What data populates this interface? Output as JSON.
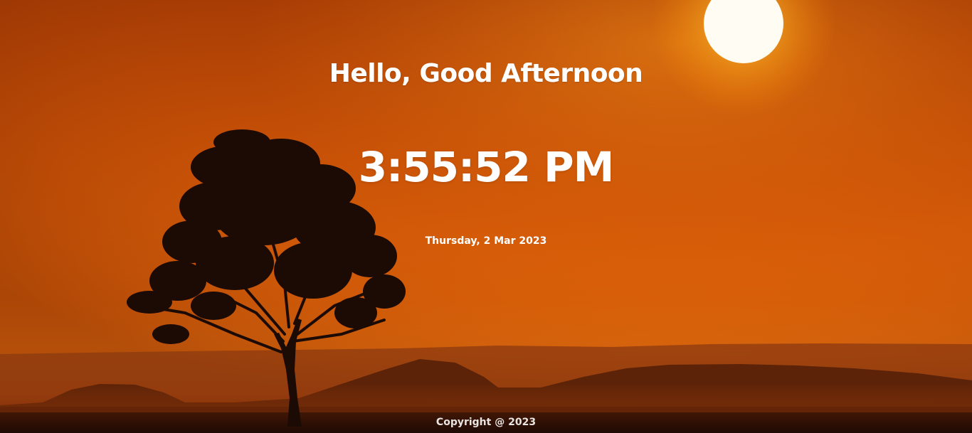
{
  "greeting": {
    "text": "Hello, Good Afternoon"
  },
  "clock": {
    "time": "3:55:52 PM"
  },
  "date": {
    "text": "Thursday, 2 Mar 2023"
  },
  "footer": {
    "copyright": "Copyright @ 2023"
  },
  "background": {
    "sky_top": "#a83a04",
    "sky_mid": "#e0640a",
    "horizon": "#f27a0c",
    "sun": "#fffdf0",
    "hills": "#3a1605",
    "tree": "#1c0a05"
  }
}
